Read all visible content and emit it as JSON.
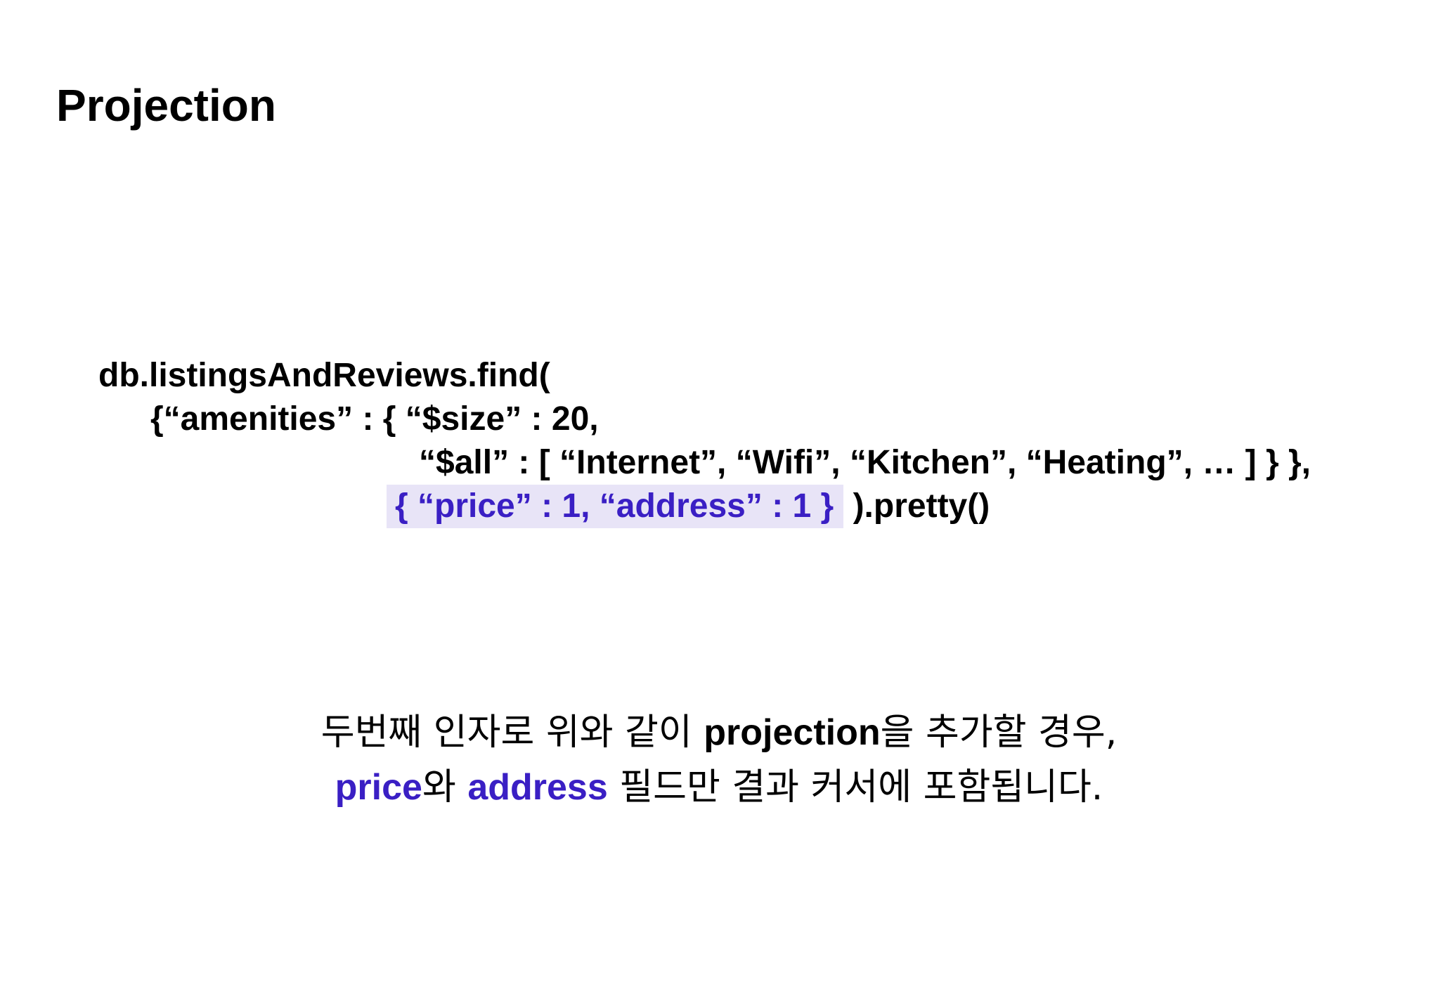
{
  "title": "Projection",
  "code": {
    "line1": "db.listingsAndReviews.find(",
    "line2": "{“amenities” : { “$size” : 20,",
    "line3": "“$all” : [ “Internet”, “Wifi”, “Kitchen”, “Heating”, … ] } },",
    "line4_projection": "{ “price” : 1, “address” : 1 }",
    "line4_rest": " ).pretty()"
  },
  "explanation": {
    "line1_prefix": "두번째 인자로 위와 같이 ",
    "line1_term": "projection",
    "line1_suffix": "을 추가할 경우,",
    "line2_term1": "price",
    "line2_mid": "와 ",
    "line2_term2": "address",
    "line2_suffix": " 필드만 결과 커서에 포함됩니다."
  },
  "colors": {
    "accent": "#3a1fc4",
    "highlight_bg": "#e8e4f7",
    "text": "#000000",
    "background": "#ffffff"
  }
}
